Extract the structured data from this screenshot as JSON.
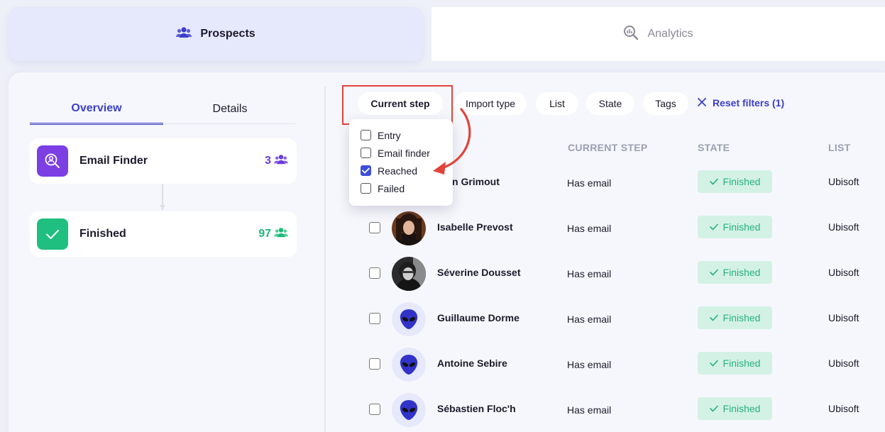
{
  "top_tabs": {
    "prospects": "Prospects",
    "analytics": "Analytics"
  },
  "sidebar": {
    "tabs": {
      "overview": "Overview",
      "details": "Details"
    },
    "steps": [
      {
        "name": "Email Finder",
        "count": "3",
        "color": "#7b3fe4",
        "icon": "user-search-icon"
      },
      {
        "name": "Finished",
        "count": "97",
        "color": "#1fbf7f",
        "icon": "check-icon"
      }
    ]
  },
  "filters": {
    "current_step": "Current step",
    "import_type": "Import type",
    "list": "List",
    "state": "State",
    "tags": "Tags",
    "reset": "Reset filters (1)"
  },
  "dropdown": {
    "options": [
      {
        "label": "Entry",
        "checked": false
      },
      {
        "label": "Email finder",
        "checked": false
      },
      {
        "label": "Reached",
        "checked": true
      },
      {
        "label": "Failed",
        "checked": false
      }
    ]
  },
  "table": {
    "headers": {
      "current_step": "CURRENT STEP",
      "state": "STATE",
      "list": "LIST"
    },
    "rows": [
      {
        "name": "than Grimout",
        "step": "Has email",
        "state": "Finished",
        "list": "Ubisoft",
        "avatar": "hidden"
      },
      {
        "name": "Isabelle Prevost",
        "step": "Has email",
        "state": "Finished",
        "list": "Ubisoft",
        "avatar": "photo"
      },
      {
        "name": "Séverine Dousset",
        "step": "Has email",
        "state": "Finished",
        "list": "Ubisoft",
        "avatar": "photo-bw"
      },
      {
        "name": "Guillaume Dorme",
        "step": "Has email",
        "state": "Finished",
        "list": "Ubisoft",
        "avatar": "alien"
      },
      {
        "name": "Antoine Sebire",
        "step": "Has email",
        "state": "Finished",
        "list": "Ubisoft",
        "avatar": "alien"
      },
      {
        "name": "Sébastien Floc'h",
        "step": "Has email",
        "state": "Finished",
        "list": "Ubisoft",
        "avatar": "alien"
      }
    ]
  },
  "colors": {
    "accent": "#3c3fc6",
    "highlight": "#e0443b",
    "state_bg": "#d3f2e5",
    "state_text": "#28b07e"
  }
}
